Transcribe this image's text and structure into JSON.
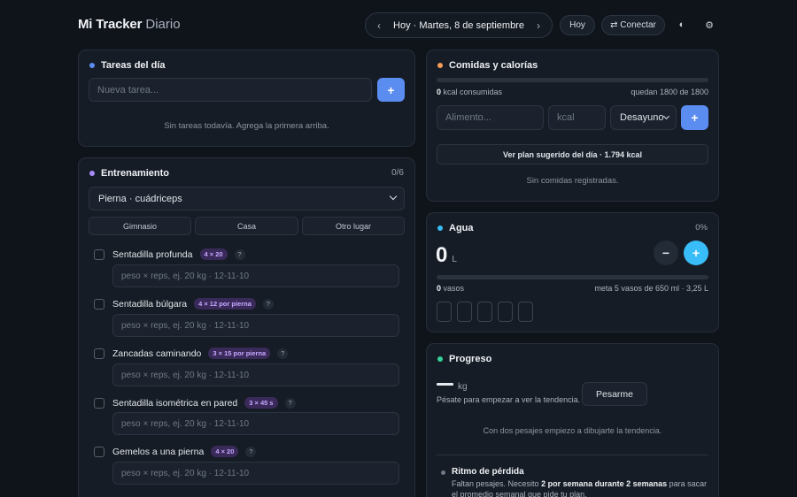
{
  "brand": {
    "bold": "Mi Tracker",
    "light": "Diario"
  },
  "datenav": {
    "prev": "‹",
    "label": "Hoy · Martes, 8 de septiembre",
    "next": "›"
  },
  "header": {
    "today_label": "Hoy",
    "connect_label": "⇄ Conectar",
    "theme_icon": "◐",
    "settings_icon": "⚙"
  },
  "tasks": {
    "title": "Tareas del día",
    "dot_color": "#5b8cf0",
    "placeholder": "Nueva tarea...",
    "add": "+",
    "empty": "Sin tareas todavía. Agrega la primera arriba."
  },
  "training": {
    "title": "Entrenamiento",
    "dot_color": "#a78bfa",
    "count": "0/6",
    "routine": "Pierna · cuádriceps",
    "locations": [
      "Gimnasio",
      "Casa",
      "Otro lugar"
    ],
    "exercises": [
      {
        "name": "Sentadilla profunda",
        "tag": "4 × 20",
        "help": "?",
        "placeholder": "peso × reps, ej. 20 kg · 12-11-10"
      },
      {
        "name": "Sentadilla búlgara",
        "tag": "4 × 12 por pierna",
        "help": "?",
        "placeholder": "peso × reps, ej. 20 kg · 12-11-10"
      },
      {
        "name": "Zancadas caminando",
        "tag": "3 × 15 por pierna",
        "help": "?",
        "placeholder": "peso × reps, ej. 20 kg · 12-11-10"
      },
      {
        "name": "Sentadilla isométrica en pared",
        "tag": "3 × 45 s",
        "help": "?",
        "placeholder": "peso × reps, ej. 20 kg · 12-11-10"
      },
      {
        "name": "Gemelos a una pierna",
        "tag": "4 × 20",
        "help": "?",
        "placeholder": "peso × reps, ej. 20 kg · 12-11-10"
      }
    ]
  },
  "meals": {
    "title": "Comidas y calorías",
    "dot_color": "#f59e5b",
    "consumed_value": "0",
    "consumed_label": "kcal consumidas",
    "remaining": "quedan 1800 de 1800",
    "progress": 0,
    "food_placeholder": "Alimento...",
    "kcal_placeholder": "kcal",
    "meal_type": "Desayuno",
    "add": "+",
    "plan_button": "Ver plan sugerido del día · 1.794 kcal",
    "empty": "Sin comidas registradas."
  },
  "water": {
    "title": "Agua",
    "dot_color": "#38bdf8",
    "percent": "0%",
    "value": "0",
    "unit": "L",
    "minus": "−",
    "plus": "+",
    "glasses_value": "0",
    "glasses_label": "vasos",
    "goal": "meta 5 vasos de 650 ml · 3,25 L",
    "progress": 0,
    "glasses_total": 5
  },
  "progress": {
    "title": "Progreso",
    "dot_color": "#34d399",
    "unit": "kg",
    "hint": "Pésate para empezar a ver la tendencia.",
    "weigh_button": "Pesarme",
    "chart_empty": "Con dos pesajes empiezo a dibujarte la tendencia.",
    "loss_title": "Ritmo de pérdida",
    "loss_text_1": "Faltan pesajes. Necesito ",
    "loss_bold": "2 por semana durante 2 semanas",
    "loss_text_2": " para sacar",
    "loss_line2": "el promedio semanal que pide tu plan."
  }
}
